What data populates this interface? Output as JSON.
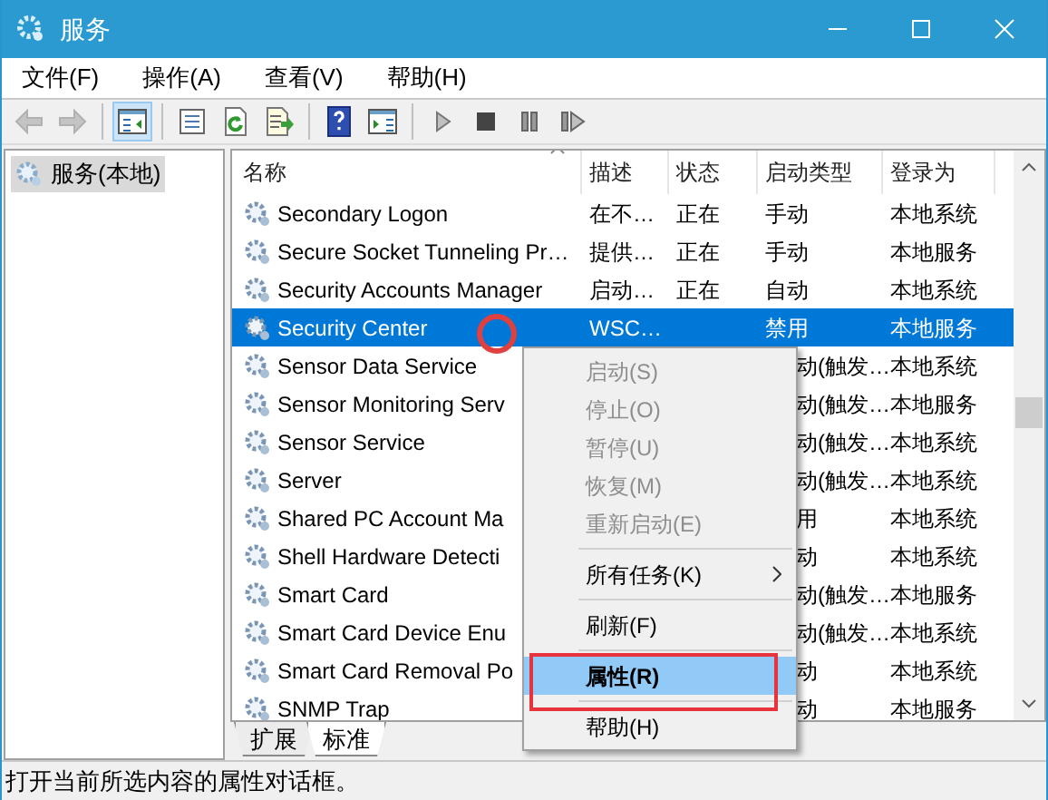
{
  "window": {
    "title": "服务"
  },
  "menu_bar": [
    "文件(F)",
    "操作(A)",
    "查看(V)",
    "帮助(H)"
  ],
  "toolbar": [
    {
      "kind": "back",
      "disabled": true
    },
    {
      "kind": "forward",
      "disabled": true
    },
    {
      "kind": "sep"
    },
    {
      "kind": "tree",
      "selected": true
    },
    {
      "kind": "sep"
    },
    {
      "kind": "props",
      "selected": false
    },
    {
      "kind": "refresh",
      "selected": false
    },
    {
      "kind": "export",
      "selected": false
    },
    {
      "kind": "sep"
    },
    {
      "kind": "help",
      "selected": false
    },
    {
      "kind": "pane",
      "selected": false
    },
    {
      "kind": "sep"
    },
    {
      "kind": "play",
      "disabled": false
    },
    {
      "kind": "stop",
      "disabled": false
    },
    {
      "kind": "pause",
      "disabled": false
    },
    {
      "kind": "resume",
      "disabled": false
    }
  ],
  "sidebar": {
    "items": [
      {
        "label": "服务(本地)",
        "selected": true
      }
    ]
  },
  "table": {
    "columns": [
      "名称",
      "描述",
      "状态",
      "启动类型",
      "登录为"
    ],
    "rows": [
      {
        "name": "Secondary Logon",
        "desc": "在不…",
        "status": "正在",
        "startup": "手动",
        "logon": "本地系统",
        "selected": false,
        "covered": false
      },
      {
        "name": "Secure Socket Tunneling Pr…",
        "desc": "提供…",
        "status": "正在",
        "startup": "手动",
        "logon": "本地服务",
        "selected": false,
        "covered": false
      },
      {
        "name": "Security Accounts Manager",
        "desc": "启动…",
        "status": "正在",
        "startup": "自动",
        "logon": "本地系统",
        "selected": false,
        "covered": false
      },
      {
        "name": "Security Center",
        "desc": "WSC…",
        "startup": "禁用",
        "logon": "本地服务",
        "selected": true,
        "covered": false
      },
      {
        "name": "Sensor Data Service",
        "startup": "动(触发…",
        "logon": "本地系统",
        "selected": false,
        "covered": true
      },
      {
        "name": "Sensor Monitoring Serv",
        "startup": "动(触发…",
        "logon": "本地服务",
        "selected": false,
        "covered": true
      },
      {
        "name": "Sensor Service",
        "startup": "动(触发…",
        "logon": "本地系统",
        "selected": false,
        "covered": true
      },
      {
        "name": "Server",
        "startup": "动(触发…",
        "logon": "本地系统",
        "selected": false,
        "covered": true
      },
      {
        "name": "Shared PC Account Ma",
        "startup": "用",
        "logon": "本地系统",
        "selected": false,
        "covered": true
      },
      {
        "name": "Shell Hardware Detecti",
        "startup": "动",
        "logon": "本地系统",
        "selected": false,
        "covered": true
      },
      {
        "name": "Smart Card",
        "startup": "动(触发…",
        "logon": "本地服务",
        "selected": false,
        "covered": true
      },
      {
        "name": "Smart Card Device Enu",
        "startup": "动(触发…",
        "logon": "本地系统",
        "selected": false,
        "covered": true
      },
      {
        "name": "Smart Card Removal Po",
        "startup": "动",
        "logon": "本地系统",
        "selected": false,
        "covered": true
      },
      {
        "name": "SNMP Trap",
        "startup": "动",
        "logon": "本地服务",
        "selected": false,
        "covered": true
      }
    ]
  },
  "tabs": [
    {
      "label": "扩展",
      "selected": false
    },
    {
      "label": "标准",
      "selected": true
    }
  ],
  "context_menu": [
    {
      "kind": "item",
      "label": "启动(S)",
      "disabled": true
    },
    {
      "kind": "item",
      "label": "停止(O)",
      "disabled": true
    },
    {
      "kind": "item",
      "label": "暂停(U)",
      "disabled": true
    },
    {
      "kind": "item",
      "label": "恢复(M)",
      "disabled": true
    },
    {
      "kind": "item",
      "label": "重新启动(E)",
      "disabled": true
    },
    {
      "kind": "sep"
    },
    {
      "kind": "submenu",
      "label": "所有任务(K)",
      "disabled": false
    },
    {
      "kind": "sep"
    },
    {
      "kind": "item",
      "label": "刷新(F)",
      "disabled": false
    },
    {
      "kind": "sep"
    },
    {
      "kind": "item",
      "label": "属性(R)",
      "disabled": false,
      "selected": true,
      "bold": true
    },
    {
      "kind": "sep"
    },
    {
      "kind": "item",
      "label": "帮助(H)",
      "disabled": false
    }
  ],
  "status_bar": "打开当前所选内容的属性对话框。"
}
